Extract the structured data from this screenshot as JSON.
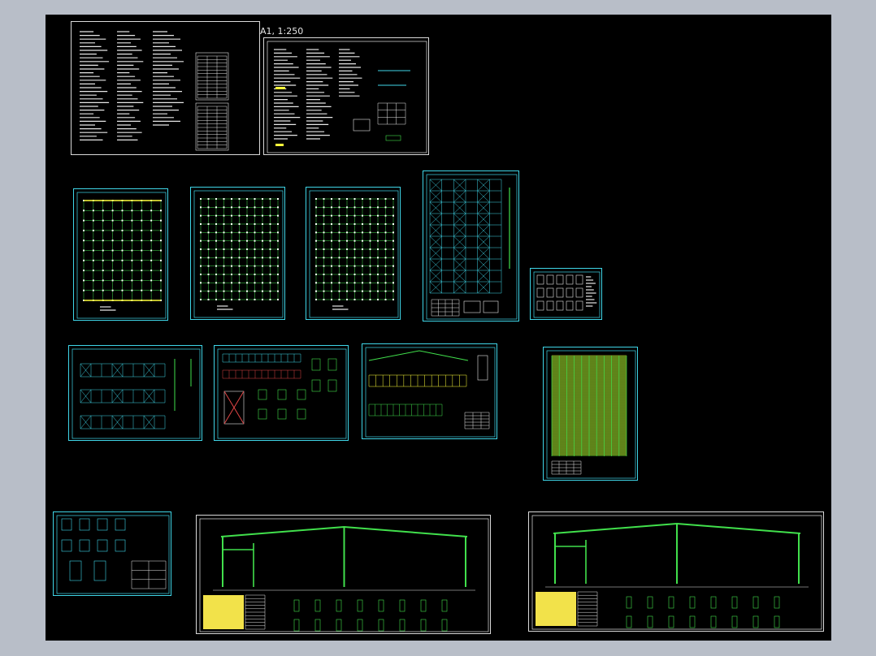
{
  "drawing": {
    "scale_label": "A1, 1:250",
    "colors": {
      "background": "#000000",
      "frame_cyan": "#3fd6e8",
      "frame_white": "#d9d9d9",
      "grid_green": "#41e04c",
      "text_white": "#e6e6e6",
      "table_yellow": "#ffff3a",
      "section_yellow": "#f2e24a"
    }
  }
}
